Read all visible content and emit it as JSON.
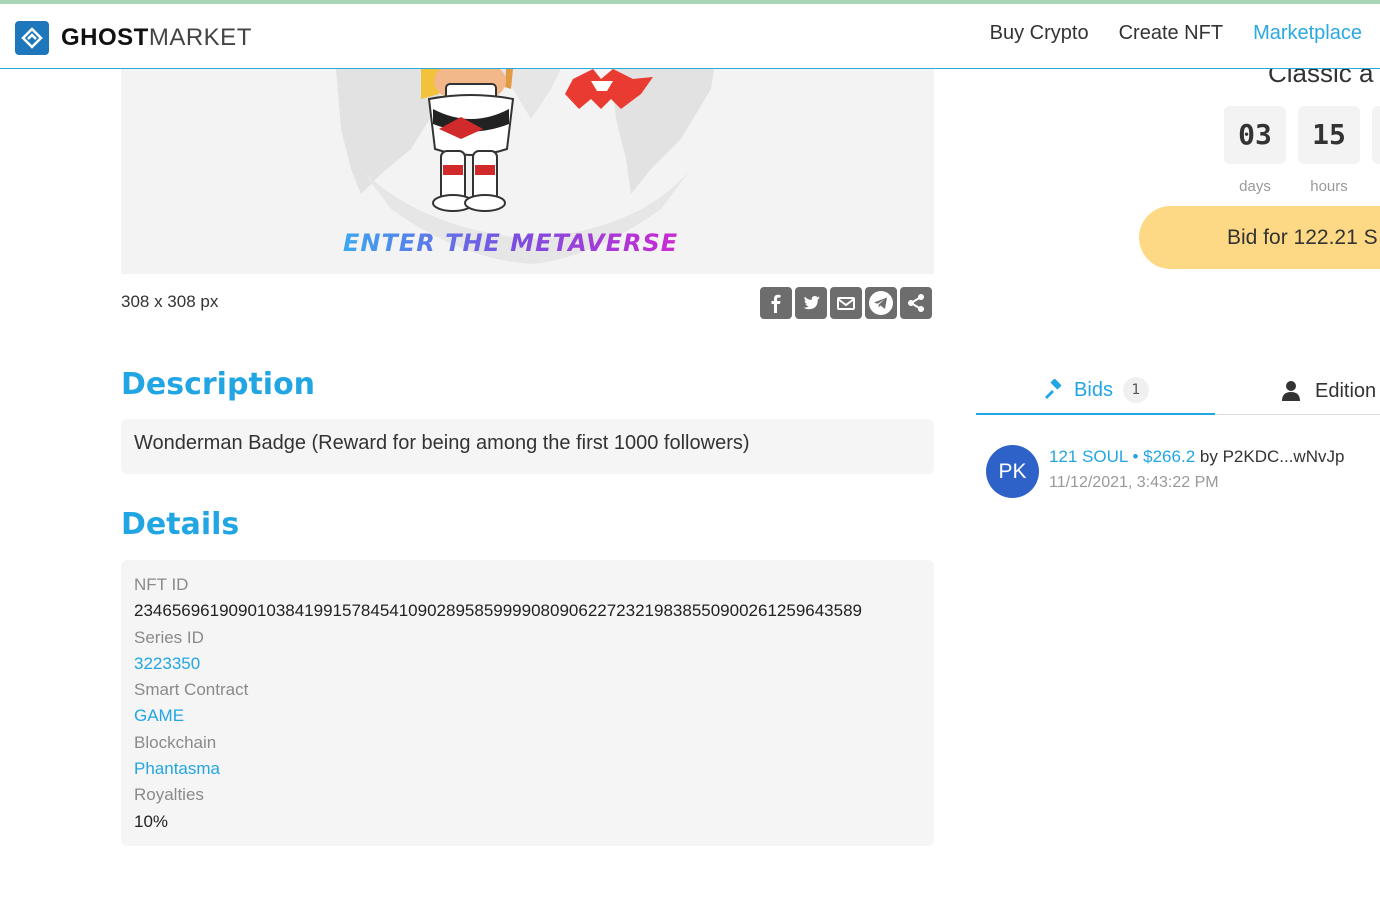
{
  "header": {
    "logo_bold": "GHOST",
    "logo_light": "MARKET",
    "nav": [
      {
        "label": "Buy Crypto",
        "active": false
      },
      {
        "label": "Create NFT",
        "active": false
      },
      {
        "label": "Marketplace",
        "active": true
      }
    ]
  },
  "nft": {
    "image_caption": "ENTER THE METAVERSE",
    "size": "308 x 308 px"
  },
  "description": {
    "heading": "Description",
    "text": "Wonderman Badge (Reward for being among the first 1000 followers)"
  },
  "details": {
    "heading": "Details",
    "nft_id_label": "NFT ID",
    "nft_id": "23465696190901038419915784541090289585999908090622723219838550900261259643589",
    "series_id_label": "Series ID",
    "series_id": "3223350",
    "contract_label": "Smart Contract",
    "contract": "GAME",
    "blockchain_label": "Blockchain",
    "blockchain": "Phantasma",
    "royalties_label": "Royalties",
    "royalties": "10%"
  },
  "auction": {
    "title": "Classic a",
    "days_value": "03",
    "days_label": "days",
    "hours_value": "15",
    "hours_label": "hours",
    "bid_button": "Bid for 122.21 S"
  },
  "tabs": {
    "bids_label": "Bids",
    "bids_count": "1",
    "edition_label": "Edition"
  },
  "bids": [
    {
      "avatar": "PK",
      "amount": "121 SOUL • $266.2",
      "by": "by P2KDC...wNvJp",
      "date": "11/12/2021, 3:43:22 PM"
    }
  ],
  "colors": {
    "accent": "#22a6e3",
    "bid_button": "#fdd985",
    "avatar": "#2f62c8",
    "logo": "#1f77bb"
  }
}
